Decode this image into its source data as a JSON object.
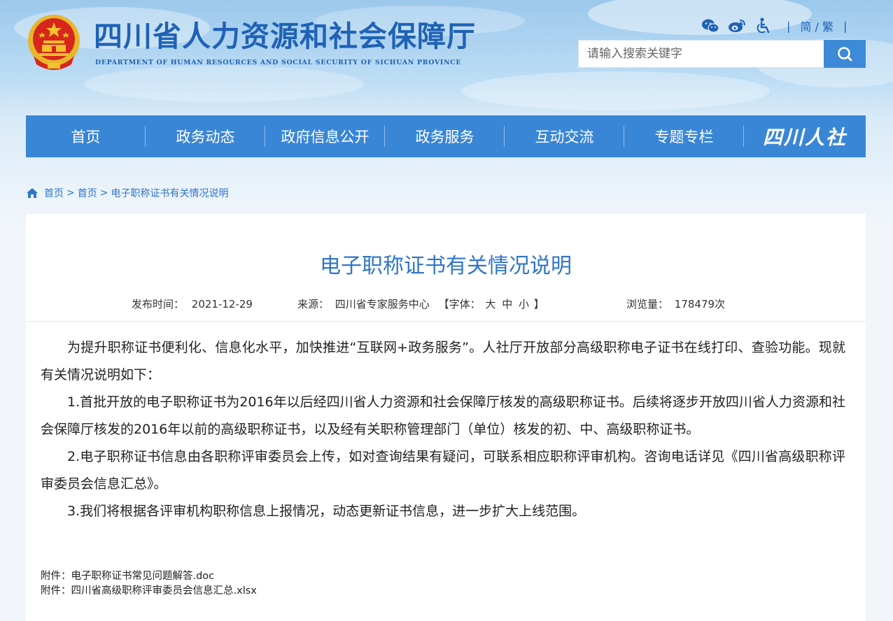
{
  "header": {
    "site_title": "四川省人力资源和社会保障厅",
    "site_subtitle": "DEPARTMENT OF HUMAN RESOURCES AND SOCIAL SECURITY OF SICHUAN PROVINCE",
    "tools": {
      "icons": [
        "wechat-icon",
        "weibo-icon",
        "accessibility-icon"
      ],
      "lang_label": "简 / 繁",
      "separator": "|"
    },
    "search": {
      "placeholder": "请输入搜索关键字",
      "button_icon": "search-icon"
    }
  },
  "nav": {
    "items": [
      {
        "label": "首页"
      },
      {
        "label": "政务动态"
      },
      {
        "label": "政府信息公开"
      },
      {
        "label": "政务服务"
      },
      {
        "label": "互动交流"
      },
      {
        "label": "专题专栏"
      }
    ],
    "brand": "四川人社"
  },
  "breadcrumb": {
    "icon": "home-icon",
    "items": [
      "首页",
      "首页",
      "电子职称证书有关情况说明"
    ],
    "separator": ">"
  },
  "article": {
    "title": "电子职称证书有关情况说明",
    "publish_label": "发布时间：",
    "publish_date": "2021-12-29",
    "source_label": "来源：",
    "source": "四川省专家服务中心",
    "font_label": "【字体：",
    "font_large": "大",
    "font_medium": "中",
    "font_small": "小",
    "font_end": "】",
    "views_label": "浏览量：",
    "views": "178479次",
    "paragraphs": [
      "为提升职称证书便利化、信息化水平，加快推进“互联网+政务服务”。人社厅开放部分高级职称电子证书在线打印、查验功能。现就有关情况说明如下：",
      "1.首批开放的电子职称证书为2016年以后经四川省人力资源和社会保障厅核发的高级职称证书。后续将逐步开放四川省人力资源和社会保障厅核发的2016年以前的高级职称证书，以及经有关职称管理部门（单位）核发的初、中、高级职称证书。",
      "2.电子职称证书信息由各职称评审委员会上传，如对查询结果有疑问，可联系相应职称评审机构。咨询电话详见《四川省高级职称评审委员会信息汇总》。",
      "3.我们将根据各评审机构职称信息上报情况，动态更新证书信息，进一步扩大上线范围。"
    ],
    "attachments": [
      {
        "label": "附件：",
        "name": "电子职称证书常见问题解答.doc"
      },
      {
        "label": "附件：",
        "name": "四川省高级职称评审委员会信息汇总.xlsx"
      }
    ]
  },
  "colors": {
    "brand_blue": "#1f62b6",
    "nav_blue": "#3a86d6",
    "link_blue": "#2f76c8",
    "emblem_red": "#d8261c",
    "emblem_gold": "#f2c12e"
  }
}
